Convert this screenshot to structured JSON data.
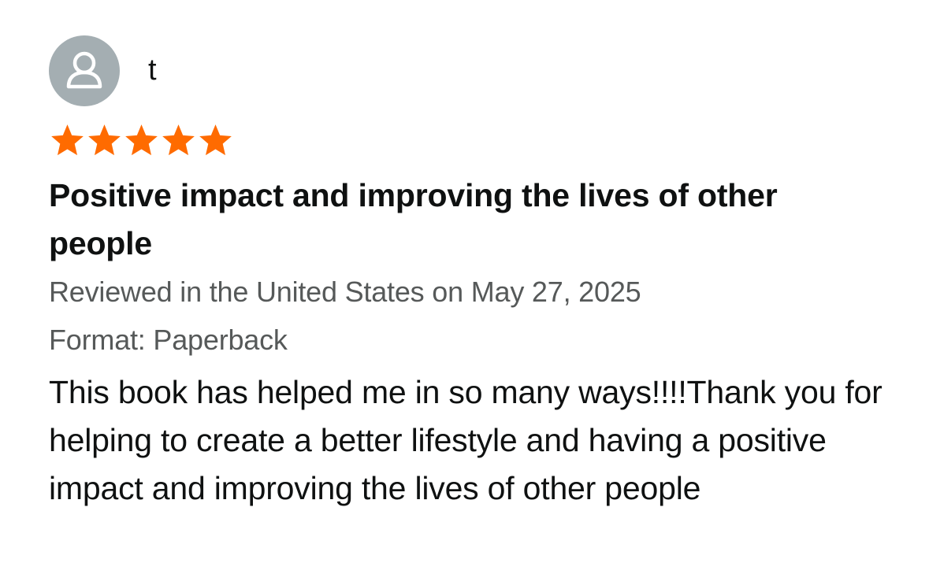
{
  "review": {
    "username": "t",
    "rating": 5,
    "rating_max": 5,
    "star_color": "#ff6b00",
    "avatar_color": "#a4aeb2",
    "avatar_icon": "person-icon",
    "title": "Positive impact and improving the lives of other people",
    "reviewed_line": "Reviewed in the United States on May 27, 2025",
    "format_line": "Format: Paperback",
    "body": "This book has helped me in so many ways!!!!Thank you for helping to create a better lifestyle and having a positive impact and improving the lives of other people"
  }
}
